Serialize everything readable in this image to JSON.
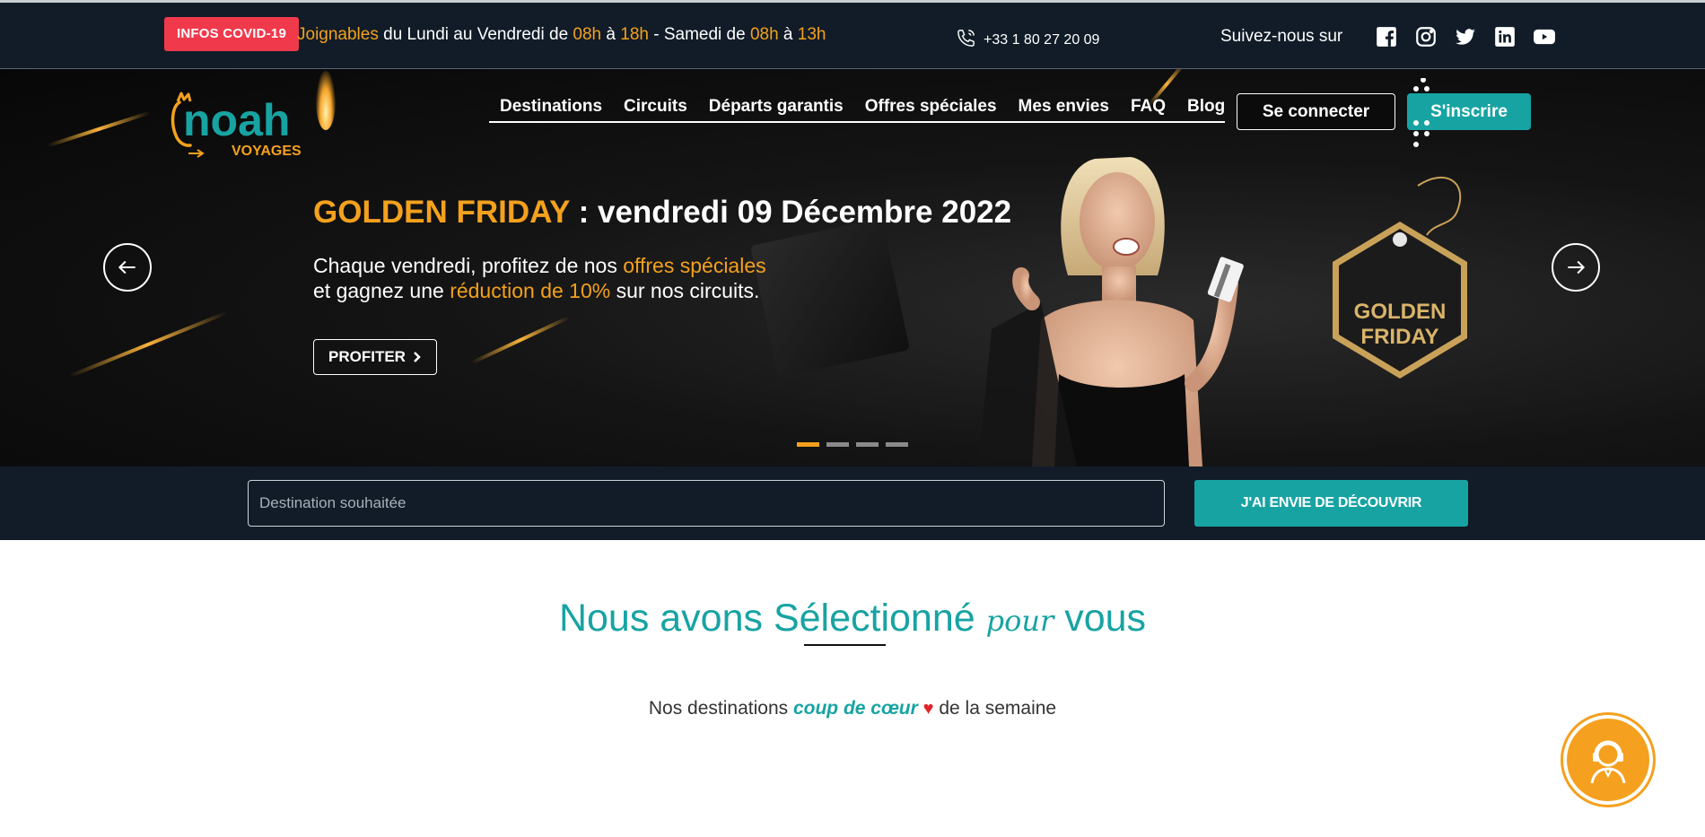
{
  "topbar": {
    "covid_label": "INFOS COVID-19",
    "hours": {
      "part1": "Joignables",
      "part2": " du Lundi au Vendredi de ",
      "t1": "08h",
      "part3": " à ",
      "t2": "18h",
      "part4": " - Samedi de ",
      "t3": "08h",
      "part5": " à ",
      "t4": "13h"
    },
    "phone": "+33 1 80 27 20 09",
    "social_label": "Suivez-nous sur",
    "social_icons": [
      "facebook-icon",
      "instagram-icon",
      "twitter-icon",
      "linkedin-icon",
      "youtube-icon"
    ]
  },
  "header": {
    "logo_word": "noah",
    "logo_sub": "VOYAGES",
    "nav": [
      "Destinations",
      "Circuits",
      "Départs garantis",
      "Offres spéciales",
      "Mes envies",
      "FAQ",
      "Blog"
    ],
    "login_label": "Se connecter",
    "signup_label": "S'inscrire"
  },
  "hero": {
    "title_gold": "GOLDEN FRIDAY",
    "title_rest": " : vendredi 09 Décembre 2022",
    "line1_a": "Chaque vendredi, profitez de nos ",
    "line1_b": "offres spéciales",
    "line2_a": "et gagnez une ",
    "line2_b": "réduction de 10%",
    "line2_c": " sur nos circuits.",
    "cta_label": "PROFITER",
    "tag_line1": "GOLDEN",
    "tag_line2": "FRIDAY",
    "slides_total": 4,
    "active_slide": 1
  },
  "search": {
    "placeholder": "Destination souhaitée",
    "value": "",
    "button_label": "J'AI ENVIE DE DÉCOUVRIR"
  },
  "selection": {
    "title_a": "Nous avons Sélectionné ",
    "title_script": "pour",
    "title_b": " vous",
    "sub_a": "Nos destinations ",
    "sub_em": "coup de cœur",
    "sub_b": " de la semaine"
  },
  "colors": {
    "brand_teal": "#18a3a3",
    "brand_gold": "#f4a11d",
    "covid_red": "#f0394b",
    "dark_navy": "#111c28"
  }
}
